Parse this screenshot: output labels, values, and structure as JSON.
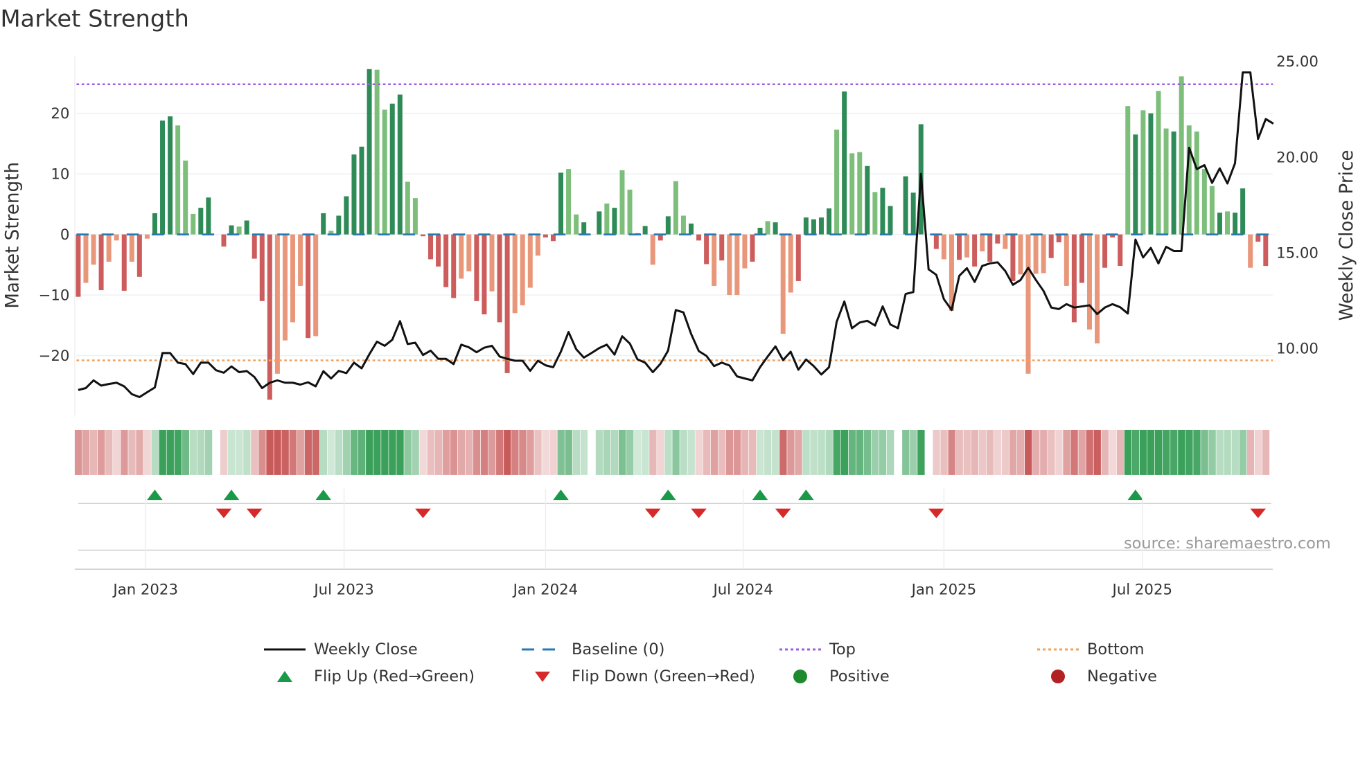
{
  "chart_data": {
    "type": "bar",
    "title": "Market Strength",
    "ylabel": "Market Strength",
    "ylabel_right": "Weekly Close Price",
    "ylim": [
      -28,
      28
    ],
    "ylim_right": [
      6.5,
      26.5
    ],
    "yticks": [
      {
        "v": 20,
        "label": "20"
      },
      {
        "v": 10,
        "label": "10"
      },
      {
        "v": 0,
        "label": "0"
      },
      {
        "v": -10,
        "label": "−10"
      },
      {
        "v": -20,
        "label": "−20"
      }
    ],
    "yticks_right": [
      {
        "v": 25,
        "label": "25.00"
      },
      {
        "v": 20,
        "label": "20.00"
      },
      {
        "v": 15,
        "label": "15.00"
      },
      {
        "v": 10,
        "label": "10.00"
      }
    ],
    "x_unit": "week index",
    "xticks": [
      {
        "week": 8.8,
        "label": "Jan 2023"
      },
      {
        "week": 34.7,
        "label": "Jul 2023"
      },
      {
        "week": 61,
        "label": "Jan 2024"
      },
      {
        "week": 86.8,
        "label": "Jul 2024"
      },
      {
        "week": 113,
        "label": "Jan 2025"
      },
      {
        "week": 138.9,
        "label": "Jul 2025"
      }
    ],
    "grid": true,
    "top_level": 24.8,
    "bottom_level": -20.8,
    "baseline": 0,
    "colors": {
      "neg_dark": "#cd5c5c",
      "neg_light": "#e9977a",
      "pos_dark": "#2e8b57",
      "pos_light": "#7dbf7a",
      "close": "#111111",
      "baseline": "#2a78b0",
      "top": "#9b5fe0",
      "bottom": "#f4a05a",
      "flip_up": "#1a9a48",
      "flip_down": "#d62a2a",
      "positive": "#1e8a2e",
      "negative": "#b22222"
    },
    "strength": {
      "values": [
        -10.3,
        -8,
        -5,
        -9.2,
        -4.5,
        -1,
        -9.3,
        -4.5,
        -7,
        -0.7,
        3.5,
        18.8,
        19.5,
        18,
        12.2,
        3.4,
        4.4,
        6.1,
        0,
        -2,
        1.5,
        1.3,
        2.3,
        -4,
        -11,
        -27.3,
        -23,
        -17.5,
        -14.5,
        -8.5,
        -17.1,
        -16.8,
        3.5,
        0.6,
        3.1,
        6.3,
        13.2,
        14.5,
        27.3,
        27.2,
        20.6,
        21.6,
        23.1,
        8.7,
        6,
        -0.3,
        -4.1,
        -5.3,
        -8.7,
        -10.5,
        -7.3,
        -6.1,
        -11,
        -13.2,
        -9.4,
        -14.5,
        -22.9,
        -13,
        -11.7,
        -8.8,
        -3.5,
        -0.5,
        -1.1,
        10.2,
        10.8,
        3.3,
        2,
        0,
        3.8,
        5.1,
        4.4,
        10.6,
        7.4,
        0.2,
        1.4,
        -5,
        -1,
        3,
        8.8,
        3.1,
        1.8,
        -1,
        -4.9,
        -8.5,
        -4.3,
        -10,
        -10,
        -5.6,
        -4.5,
        1.1,
        2.2,
        2,
        -16.4,
        -9.6,
        -7.7,
        2.8,
        2.5,
        2.8,
        4.3,
        17.3,
        23.6,
        13.4,
        13.6,
        11.3,
        7,
        7.7,
        4.7,
        0,
        9.6,
        6.9,
        18.2,
        0,
        -2.4,
        -4.1,
        -12.6,
        -4.2,
        -3.8,
        -5.3,
        -2.8,
        -4.5,
        -1.5,
        -2.4,
        -7.7,
        -6.6,
        -23,
        -6.5,
        -6.4,
        -3.9,
        -1.3,
        -8.5,
        -14.5,
        -8,
        -15.7,
        -18,
        -5.5,
        -0.5,
        -5.2,
        21.2,
        16.5,
        20.5,
        20,
        23.7,
        17.5,
        17,
        26.1,
        18,
        17,
        10.8,
        8,
        3.6,
        3.8,
        3.6,
        7.6,
        -5.5,
        -1.2,
        -5.2
      ],
      "shade": "DLLDLLDLDLDDDLLLDD-DDLDDDDLLLLDLDLDDDDDLLDDLLDDDDDLLDDLDDLLLLDDDLL-DDLDLLDDLDDLL DDDLDLLLDDLDLLDDDDDLDLLDL-DLD-DDDLLDLDLDDLDLLLLDDLDDLLDDDLDLDLLDLLLLLDLDDLD"
    },
    "weekly_close": [
      7.77,
      7.87,
      8.27,
      8.0,
      8.08,
      8.15,
      7.96,
      7.55,
      7.4,
      7.65,
      7.9,
      9.7,
      9.7,
      9.2,
      9.12,
      8.6,
      9.2,
      9.2,
      8.8,
      8.67,
      9.0,
      8.7,
      8.76,
      8.45,
      7.87,
      8.15,
      8.27,
      8.15,
      8.15,
      8.05,
      8.17,
      7.96,
      8.75,
      8.37,
      8.77,
      8.65,
      9.2,
      8.9,
      9.64,
      10.3,
      10.08,
      10.4,
      11.37,
      10.17,
      10.24,
      9.6,
      9.83,
      9.4,
      9.4,
      9.12,
      10.14,
      10.0,
      9.74,
      9.98,
      10.08,
      9.52,
      9.4,
      9.3,
      9.3,
      8.77,
      9.3,
      9.06,
      8.96,
      9.77,
      10.8,
      9.9,
      9.46,
      9.7,
      9.96,
      10.14,
      9.62,
      10.58,
      10.2,
      9.37,
      9.2,
      8.7,
      9.14,
      9.83,
      11.95,
      11.83,
      10.7,
      9.8,
      9.55,
      9.02,
      9.2,
      9.05,
      8.48,
      8.37,
      8.27,
      8.96,
      9.52,
      10.05,
      9.33,
      9.77,
      8.83,
      9.36,
      9.02,
      8.58,
      8.96,
      11.33,
      12.4,
      11.0,
      11.3,
      11.39,
      11.14,
      12.14,
      11.2,
      11.0,
      12.79,
      12.89,
      19.07,
      14.08,
      13.79,
      12.52,
      11.95,
      13.74,
      14.14,
      13.42,
      14.26,
      14.39,
      14.45,
      14.0,
      13.27,
      13.52,
      14.16,
      13.52,
      12.95,
      12.08,
      12.0,
      12.26,
      12.08,
      12.14,
      12.2,
      11.74,
      12.08,
      12.26,
      12.1,
      11.77,
      15.64,
      14.7,
      15.2,
      14.39,
      15.26,
      15.04,
      15.04,
      20.44,
      19.32,
      19.53,
      18.6,
      19.36,
      18.57,
      19.63,
      24.38,
      24.38,
      20.9,
      21.94,
      21.7
    ],
    "flip_up_weeks": [
      10,
      20,
      32,
      63,
      77,
      89,
      95,
      138
    ],
    "flip_down_weeks": [
      19,
      23,
      45,
      75,
      81,
      92,
      112,
      154
    ],
    "source": "source: sharemaestro.com",
    "legend": [
      {
        "label": "Weekly Close",
        "symbol": "line"
      },
      {
        "label": "Baseline (0)",
        "symbol": "dashed"
      },
      {
        "label": "Top",
        "symbol": "dotted-top"
      },
      {
        "label": "Bottom",
        "symbol": "dotted-bottom"
      },
      {
        "label": "Flip Up (Red→Green)",
        "symbol": "triangle-up"
      },
      {
        "label": "Flip Down (Green→Red)",
        "symbol": "triangle-down"
      },
      {
        "label": "Positive",
        "symbol": "dot-green"
      },
      {
        "label": "Negative",
        "symbol": "dot-red"
      }
    ]
  }
}
